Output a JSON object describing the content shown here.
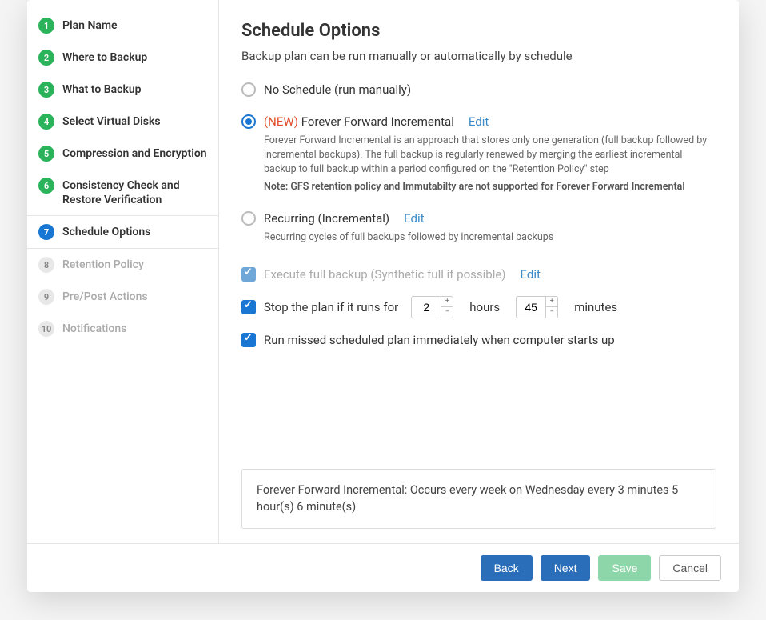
{
  "sidebar": {
    "steps": [
      {
        "num": "1",
        "label": "Plan Name",
        "state": "done"
      },
      {
        "num": "2",
        "label": "Where to Backup",
        "state": "done"
      },
      {
        "num": "3",
        "label": "What to Backup",
        "state": "done"
      },
      {
        "num": "4",
        "label": "Select Virtual Disks",
        "state": "done"
      },
      {
        "num": "5",
        "label": "Compression and Encryption",
        "state": "done"
      },
      {
        "num": "6",
        "label": "Consistency Check and Restore Verification",
        "state": "done"
      },
      {
        "num": "7",
        "label": "Schedule Options",
        "state": "active"
      },
      {
        "num": "8",
        "label": "Retention Policy",
        "state": "pending"
      },
      {
        "num": "9",
        "label": "Pre/Post Actions",
        "state": "pending"
      },
      {
        "num": "10",
        "label": "Notifications",
        "state": "pending"
      }
    ]
  },
  "main": {
    "title": "Schedule Options",
    "subtitle": "Backup plan can be run manually or automatically by schedule",
    "options": {
      "no_schedule": {
        "label": "No Schedule (run manually)"
      },
      "ffi": {
        "new_tag": "(NEW)",
        "label": "Forever Forward Incremental",
        "edit": "Edit",
        "desc": "Forever Forward Incremental is an approach that stores only one generation (full backup followed by incremental backups). The full backup is regularly renewed by merging the earliest incremental backup to full backup within a period configured on the \"Retention Policy\" step",
        "note": "Note: GFS retention policy and Immutabilty are not supported for Forever Forward Incremental"
      },
      "recurring": {
        "label": "Recurring (Incremental)",
        "edit": "Edit",
        "desc": "Recurring cycles of full backups followed by incremental backups"
      }
    },
    "checkboxes": {
      "exec_full": {
        "label": "Execute full backup (Synthetic full if possible)",
        "edit": "Edit"
      },
      "stop_plan": {
        "label": "Stop the plan if it runs for",
        "hours_value": "2",
        "hours_unit": "hours",
        "minutes_value": "45",
        "minutes_unit": "minutes"
      },
      "run_missed": {
        "label": "Run missed scheduled plan immediately when computer starts up"
      }
    },
    "summary": "Forever Forward Incremental: Occurs every week on Wednesday every 3 minutes 5 hour(s) 6 minute(s)"
  },
  "footer": {
    "back": "Back",
    "next": "Next",
    "save": "Save",
    "cancel": "Cancel"
  }
}
